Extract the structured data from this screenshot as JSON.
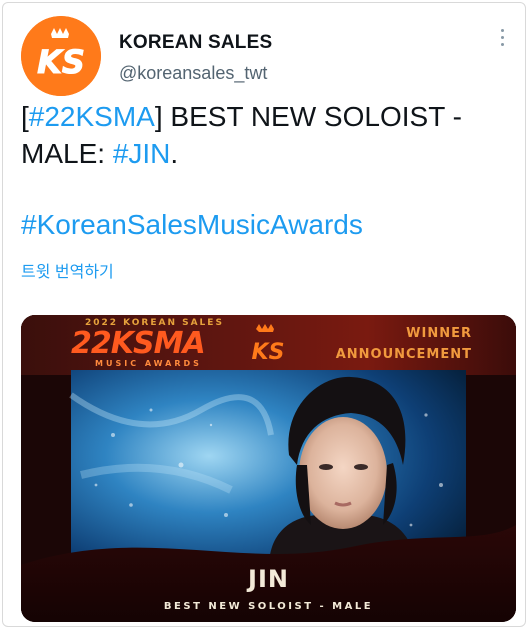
{
  "account": {
    "name": "KOREAN SALES",
    "handle": "@koreansales_twt",
    "avatar_letters": "KS",
    "avatar_color": "#ff7a1a"
  },
  "tweet": {
    "text_open_bracket": "[",
    "tag_ksma": "#22KSMA",
    "text_after_tag": "] BEST NEW SOLOIST -",
    "text_line2_prefix": "MALE: ",
    "tag_jin": "#JIN",
    "text_end": ".",
    "hashtag": "#KoreanSalesMusicAwards",
    "translate_label": "트윗 번역하기",
    "link_color": "#1d9bf0"
  },
  "card": {
    "top_small": "2022 KOREAN SALES",
    "logo_big": "22KSMA",
    "logo_sub": "MUSIC AWARDS",
    "badge_letters": "KS",
    "winner_line1": "WINNER",
    "winner_line2": "ANNOUNCEMENT",
    "artist": "JIN",
    "category": "BEST NEW SOLOIST - MALE",
    "accent_color": "#f19a3e"
  },
  "icons": {
    "more": "more-options-icon"
  }
}
